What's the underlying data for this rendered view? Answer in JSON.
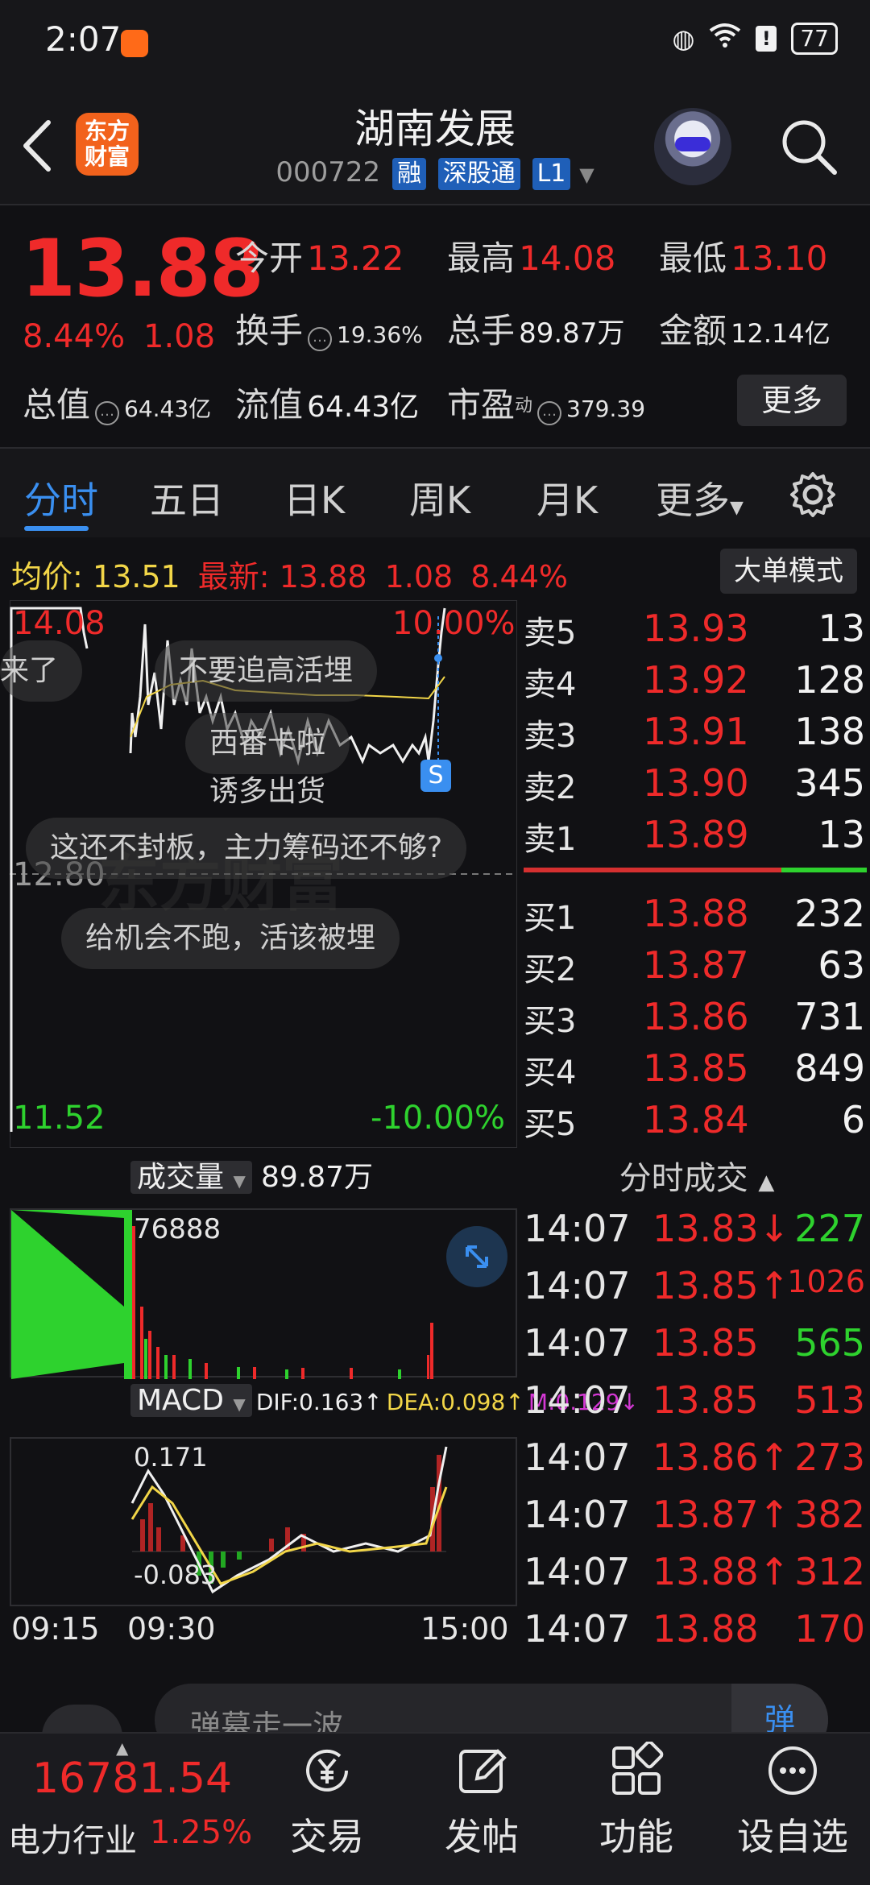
{
  "status_bar": {
    "time": "2:07",
    "battery": "77"
  },
  "header": {
    "stock_name": "湖南发展",
    "code": "000722",
    "tags": [
      "融",
      "深股通",
      "L1"
    ],
    "logo_text": "东方财富"
  },
  "quote": {
    "price": "13.88",
    "change_pct": "8.44%",
    "change": "1.08",
    "open_label": "今开",
    "open": "13.22",
    "high_label": "最高",
    "high": "14.08",
    "low_label": "最低",
    "low": "13.10",
    "turnover_label": "换手",
    "turnover": "19.36%",
    "volume_label": "总手",
    "volume": "89.87万",
    "amount_label": "金额",
    "amount": "12.14亿",
    "mktcap_label": "总值",
    "mktcap": "64.43亿",
    "float_label": "流值",
    "float_cap": "64.43亿",
    "pe_label": "市盈",
    "pe_sup": "动",
    "pe": "379.39",
    "more_label": "更多"
  },
  "tabs": [
    "分时",
    "五日",
    "日K",
    "周K",
    "月K",
    "更多"
  ],
  "avg_line": {
    "avg_label": "均价:",
    "avg": "13.51",
    "latest_label": "最新:",
    "latest": "13.88",
    "change": "1.08",
    "change_pct": "8.44%",
    "mode_button": "大单模式"
  },
  "chart_labels": {
    "top_price": "14.08",
    "mid_price": "12.80",
    "low_price": "11.52",
    "top_pct": "10.00%",
    "low_pct": "-10.00%",
    "watermark": "东方财富",
    "s_marker": "S"
  },
  "danmu": [
    "来了",
    "不要追高活埋",
    "西番卡啦",
    "诱多出货",
    "这还不封板，主力筹码还不够?",
    "给机会不跑，活该被埋"
  ],
  "order_book": {
    "asks": [
      {
        "label": "卖5",
        "price": "13.93",
        "vol": "13"
      },
      {
        "label": "卖4",
        "price": "13.92",
        "vol": "128"
      },
      {
        "label": "卖3",
        "price": "13.91",
        "vol": "138"
      },
      {
        "label": "卖2",
        "price": "13.90",
        "vol": "345"
      },
      {
        "label": "卖1",
        "price": "13.89",
        "vol": "13"
      }
    ],
    "bids": [
      {
        "label": "买1",
        "price": "13.88",
        "vol": "232"
      },
      {
        "label": "买2",
        "price": "13.87",
        "vol": "63"
      },
      {
        "label": "买3",
        "price": "13.86",
        "vol": "731"
      },
      {
        "label": "买4",
        "price": "13.85",
        "vol": "849"
      },
      {
        "label": "买5",
        "price": "13.84",
        "vol": "6"
      }
    ]
  },
  "volume_section": {
    "label": "成交量",
    "total": "89.87万",
    "max": "76888"
  },
  "macd_section": {
    "label": "MACD",
    "dif": "DIF:0.163↑",
    "dea": "DEA:0.098↑",
    "m": "M:0.129↓",
    "top": "0.171",
    "bottom": "-0.083"
  },
  "time_axis": [
    "09:15",
    "09:30",
    "15:00"
  ],
  "trades_header": "分时成交",
  "trades": [
    {
      "time": "14:07",
      "price": "13.83↓",
      "vol": "227",
      "vol_color": "#2ed22e"
    },
    {
      "time": "14:07",
      "price": "13.85↑",
      "vol": "1026",
      "vol_color": "#ef2a2a"
    },
    {
      "time": "14:07",
      "price": "13.85",
      "vol": "565",
      "vol_color": "#2ed22e"
    },
    {
      "time": "14:07",
      "price": "13.85",
      "vol": "513",
      "vol_color": "#ef2a2a"
    },
    {
      "time": "14:07",
      "price": "13.86↑",
      "vol": "273",
      "vol_color": "#ef2a2a"
    },
    {
      "time": "14:07",
      "price": "13.87↑",
      "vol": "382",
      "vol_color": "#ef2a2a"
    },
    {
      "time": "14:07",
      "price": "13.88↑",
      "vol": "312",
      "vol_color": "#ef2a2a"
    },
    {
      "time": "14:07",
      "price": "13.88",
      "vol": "170",
      "vol_color": "#ef2a2a"
    }
  ],
  "comment_bar": {
    "placeholder": "弹幕走一波",
    "button": "弹"
  },
  "bottom_nav": {
    "index_value": "16781.54",
    "index_name": "电力行业",
    "index_pct": "1.25%",
    "items": [
      "交易",
      "发帖",
      "功能",
      "设自选"
    ]
  },
  "colors": {
    "up": "#ef2a2a",
    "down": "#2ed22e",
    "accent": "#3a8ff0",
    "bg": "#111114"
  }
}
